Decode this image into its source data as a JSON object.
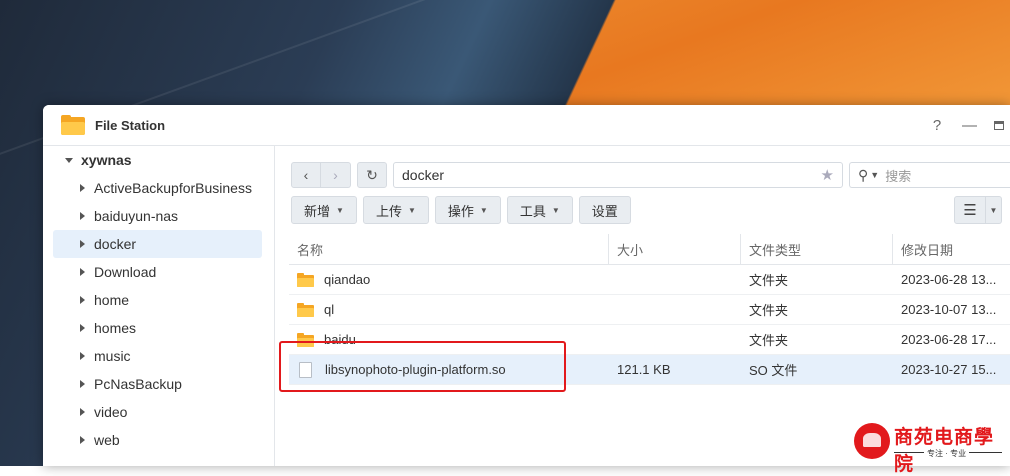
{
  "window": {
    "title": "File Station",
    "controls": {
      "help": "?",
      "minimize": "—"
    }
  },
  "sidebar": {
    "root": "xywnas",
    "items": [
      {
        "label": "ActiveBackupforBusiness"
      },
      {
        "label": "baiduyun-nas"
      },
      {
        "label": "docker",
        "selected": true
      },
      {
        "label": "Download"
      },
      {
        "label": "home"
      },
      {
        "label": "homes"
      },
      {
        "label": "music"
      },
      {
        "label": "PcNasBackup"
      },
      {
        "label": "video"
      },
      {
        "label": "web"
      }
    ]
  },
  "toolbar": {
    "back": "‹",
    "forward": "›",
    "refresh": "↻",
    "path": "docker",
    "favorite": "★",
    "search_placeholder": "搜索",
    "buttons": {
      "create": "新增",
      "upload": "上传",
      "action": "操作",
      "tools": "工具",
      "settings": "设置"
    }
  },
  "table": {
    "headers": {
      "name": "名称",
      "size": "大小",
      "type": "文件类型",
      "modified": "修改日期"
    },
    "rows": [
      {
        "kind": "folder",
        "name": "qiandao",
        "size": "",
        "type": "文件夹",
        "modified": "2023-06-28 13..."
      },
      {
        "kind": "folder",
        "name": "ql",
        "size": "",
        "type": "文件夹",
        "modified": "2023-10-07 13..."
      },
      {
        "kind": "folder",
        "name": "baidu",
        "size": "",
        "type": "文件夹",
        "modified": "2023-06-28 17..."
      },
      {
        "kind": "file",
        "name": "libsynophoto-plugin-platform.so",
        "size": "121.1 KB",
        "type": "SO 文件",
        "modified": "2023-10-27 15...",
        "selected": true
      }
    ]
  },
  "watermark": {
    "name": "商苑电商學院",
    "slogan": "专注 · 专业"
  },
  "colors": {
    "accent": "#e2191c",
    "selection": "#e6f0fb",
    "folder": "#f5a623"
  }
}
